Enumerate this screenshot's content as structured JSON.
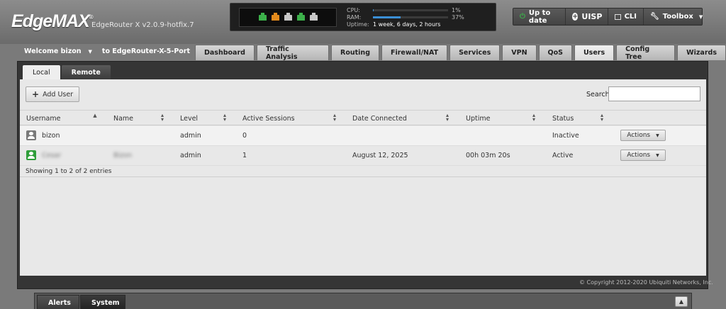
{
  "header": {
    "logo": "EdgeMAX",
    "logo_mark": "®",
    "version": "EdgeRouter X v2.0.9-hotfix.7",
    "stats": {
      "cpu_label": "CPU:",
      "cpu_value": "1%",
      "cpu_fraction": 0.01,
      "ram_label": "RAM:",
      "ram_value": "37%",
      "ram_fraction": 0.37,
      "uptime_label": "Uptime:",
      "uptime_value": "1 week, 6 days, 2 hours"
    },
    "ports": [
      {
        "name": "eth0",
        "color": "#3cb04a"
      },
      {
        "name": "eth1",
        "color": "#e28a1c"
      },
      {
        "name": "eth2",
        "color": "#c8c8c8"
      },
      {
        "name": "eth3",
        "color": "#3cb04a"
      },
      {
        "name": "eth4",
        "color": "#c8c8c8"
      }
    ],
    "buttons": {
      "uptodate": "Up to date",
      "uisp": "UISP",
      "cli": "CLI",
      "toolbox": "Toolbox"
    }
  },
  "welcome": {
    "greeting": "Welcome bizon",
    "router": "to EdgeRouter-X-5-Port"
  },
  "nav": {
    "tabs": [
      "Dashboard",
      "Traffic Analysis",
      "Routing",
      "Firewall/NAT",
      "Services",
      "VPN",
      "QoS",
      "Users",
      "Config Tree",
      "Wizards"
    ],
    "active": "Users"
  },
  "subtabs": {
    "local": "Local",
    "remote": "Remote"
  },
  "toolbar": {
    "add_user": "Add User",
    "search_label": "Search",
    "search_value": ""
  },
  "table": {
    "headers": [
      "Username",
      "Name",
      "Level",
      "Active Sessions",
      "Date Connected",
      "Uptime",
      "Status"
    ],
    "rows": [
      {
        "username": "bizon",
        "name": "",
        "level": "admin",
        "sessions": "0",
        "date": "",
        "uptime": "",
        "status": "Inactive",
        "actions": "Actions",
        "avatar_color": "#7a7a7a"
      },
      {
        "username": "Cesar",
        "name": "Bizon",
        "level": "admin",
        "sessions": "1",
        "date": "August 12, 2025",
        "uptime": "00h 03m 20s",
        "status": "Active",
        "actions": "Actions",
        "avatar_color": "#2f9e3a"
      }
    ],
    "showing": "Showing 1 to 2 of 2 entries"
  },
  "footer": {
    "copyright": "© Copyright 2012-2020 Ubiquiti Networks, Inc."
  },
  "bottom": {
    "alerts": "Alerts",
    "system": "System"
  }
}
